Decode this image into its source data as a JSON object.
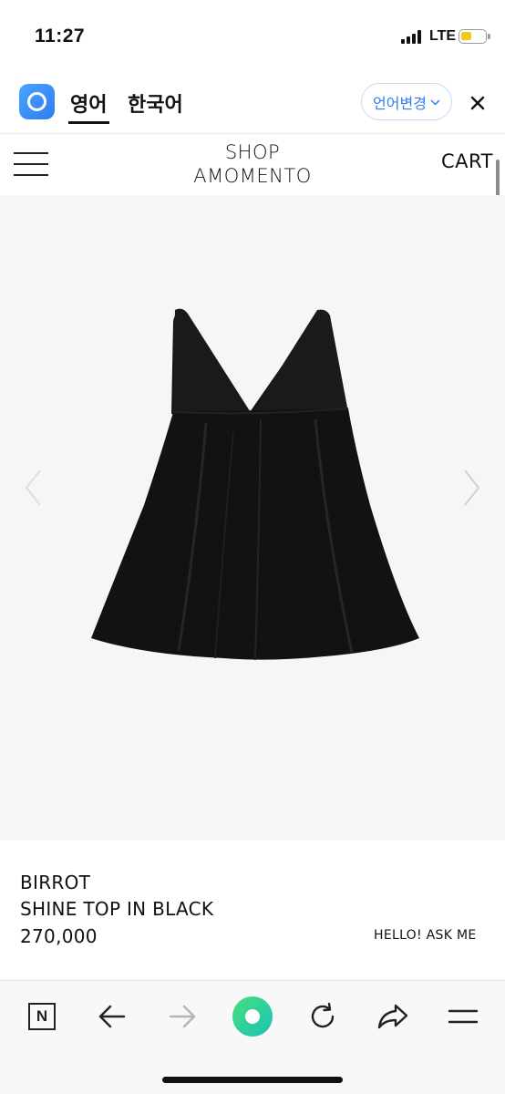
{
  "status_bar": {
    "time": "11:27",
    "network": "LTE",
    "battery_level": 0.45,
    "battery_color": "#f2c81e"
  },
  "translate_bar": {
    "tabs": [
      {
        "label": "영어",
        "active": true
      },
      {
        "label": "한국어",
        "active": false
      }
    ],
    "change_language_label": "언어변경",
    "close_icon": "close-icon",
    "accent_color": "#2f7df0"
  },
  "header": {
    "logo_line1": "SHOP",
    "logo_line2": "AMOMENTO",
    "cart_label": "CART",
    "menu_icon": "hamburger-menu-icon"
  },
  "product": {
    "brand": "BIRROT",
    "name": "SHINE TOP IN BLACK",
    "price": "270,000",
    "ask_label": "HELLO! ASK ME",
    "image_icon": "black-pinafore-top-image"
  },
  "browser_toolbar": {
    "icons": [
      "naver-home-icon",
      "back-arrow-icon",
      "forward-arrow-icon",
      "green-home-dot-icon",
      "reload-icon",
      "share-icon",
      "menu-icon"
    ],
    "naver_letter": "N"
  }
}
